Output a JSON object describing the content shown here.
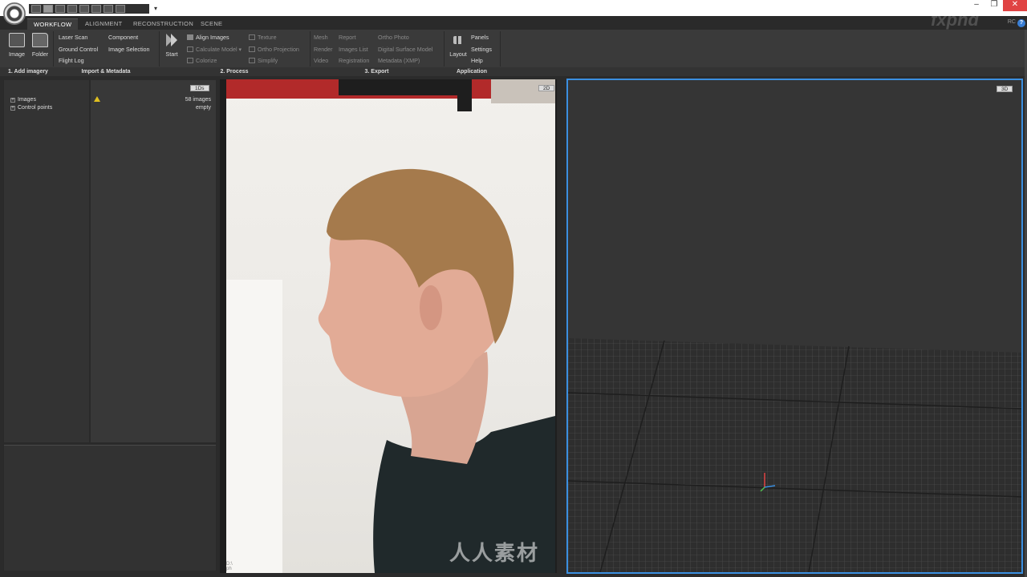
{
  "qa_menu": "▾",
  "window_controls": {
    "minimize": "‒",
    "restore": "❐",
    "close": "✕"
  },
  "tabs": [
    {
      "label": "WORKFLOW",
      "active": true
    },
    {
      "label": "ALIGNMENT",
      "active": false
    },
    {
      "label": "RECONSTRUCTION",
      "active": false
    },
    {
      "label": "SCENE",
      "active": false
    }
  ],
  "user_badge": "RC",
  "help_label": "?",
  "ribbon": {
    "add_imagery": {
      "image": "Image",
      "folder": "Folder"
    },
    "import": {
      "laser_scan": "Laser Scan",
      "ground_control": "Ground Control",
      "flight_log": "Flight Log",
      "component": "Component",
      "image_selection": "Image Selection"
    },
    "process": {
      "start": "Start",
      "align_images": "Align Images",
      "calculate_model": "Calculate Model",
      "colorize": "Colorize",
      "texture": "Texture",
      "ortho_projection": "Ortho Projection",
      "simplify": "Simplify"
    },
    "export": {
      "mesh": "Mesh",
      "render": "Render",
      "video": "Video",
      "report": "Report",
      "images_list": "Images List",
      "registration": "Registration",
      "ortho_photo": "Ortho Photo",
      "dsm": "Digital Surface Model",
      "metadata": "Metadata (XMP)"
    },
    "application": {
      "layout": "Layout",
      "panels": "Panels",
      "settings": "Settings",
      "help": "Help"
    },
    "groups": [
      "1. Add imagery",
      "Import & Metadata",
      "2. Process",
      "3. Export",
      "Application"
    ]
  },
  "panel1": {
    "badge": "1Ds",
    "tree": [
      {
        "expander": "+",
        "label": "Images"
      },
      {
        "expander": "+",
        "label": "Control points"
      }
    ],
    "values": [
      "58 images",
      "empty"
    ]
  },
  "view2d": {
    "badge": "2D",
    "caption_1": "D:\\",
    "caption_2": "ph"
  },
  "view3d": {
    "badge": "3D"
  },
  "watermark": "人人素材",
  "brand": "fxphd",
  "colors": {
    "accent": "#3b8fe0",
    "close": "#e04343",
    "warning": "#e0c020"
  }
}
